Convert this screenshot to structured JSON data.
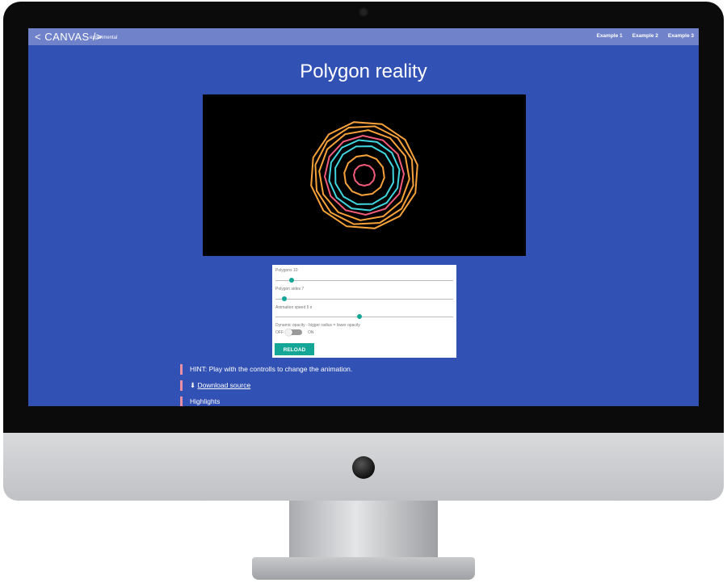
{
  "app": {
    "brand": "< CANVAS />",
    "brand_sub": "experimental",
    "nav": [
      "Example 1",
      "Example 2",
      "Example 3"
    ]
  },
  "page": {
    "title": "Polygon reality"
  },
  "controls": {
    "polygons": {
      "label": "Polygons 10",
      "value": 10
    },
    "sides": {
      "label": "Polygon sides 7",
      "value": 7
    },
    "speed": {
      "label": "Animation speed 5 s",
      "value": 5
    },
    "opacity_label": "Dynamic opacity - bigger radius = lower opacity",
    "toggle_off": "OFF",
    "toggle_on": "ON",
    "toggle_state": "off",
    "reload_label": "RELOAD"
  },
  "info": {
    "hint": "HINT: Play with the controlls to change the animation.",
    "download": "Download source",
    "highlights": "Highlights"
  },
  "colors": {
    "background": "#3251b4",
    "topbar": "#6f82ca",
    "accent": "#14a697",
    "border_accent": "#e88fa3",
    "polygon_colors": [
      "#f7a13a",
      "#f25c7a",
      "#3fd6e0"
    ]
  },
  "icons": {
    "download": "download-icon"
  }
}
